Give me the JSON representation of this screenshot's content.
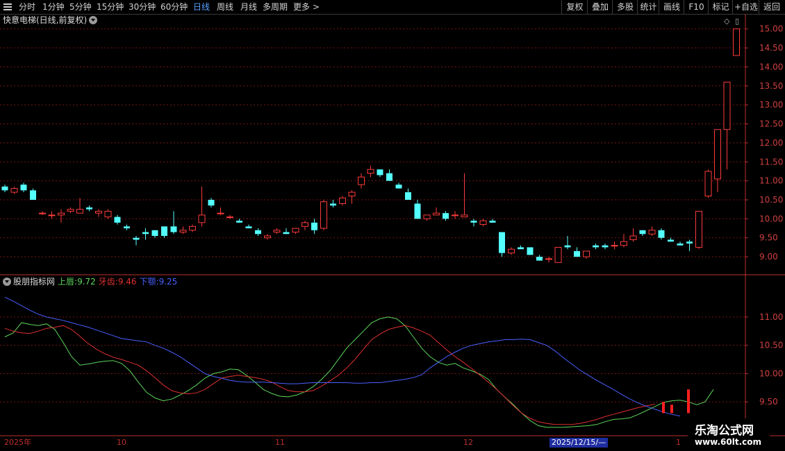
{
  "toolbar": {
    "periods": [
      "分时",
      "1分钟",
      "5分钟",
      "15分钟",
      "30分钟",
      "60分钟",
      "日线",
      "周线",
      "月线",
      "多周期",
      "更多 >"
    ],
    "active_period": "日线",
    "actions": [
      "复权",
      "叠加",
      "多股",
      "统计",
      "画线",
      "F10",
      "标记",
      "+自选",
      "返回"
    ]
  },
  "stock": {
    "title": "快意电梯(日线,前复权)"
  },
  "indicator": {
    "name": "股朋指标网",
    "items": [
      {
        "label": "上唇:",
        "value": "9.72",
        "color": "#5cd65c"
      },
      {
        "label": "牙齿:",
        "value": "9.46",
        "color": "#e03030"
      },
      {
        "label": "下颚:",
        "value": "9.25",
        "color": "#4a60ff"
      }
    ]
  },
  "time_axis": {
    "labels": [
      "2025年",
      "10",
      "11",
      "12",
      "1"
    ],
    "cursor_date": "2025/12/15/—"
  },
  "watermark": {
    "line1": "乐淘公式网",
    "line2": "www.60lt.com"
  },
  "colors": {
    "up": "#ff3b3b",
    "down": "#54ffff",
    "grid": "#7a1515",
    "lips": "#5cd65c",
    "teeth": "#e03030",
    "jaw": "#4a60ff",
    "axis": "#c03030"
  },
  "chart_data": [
    {
      "type": "candlestick",
      "title": "快意电梯(日线,前复权)",
      "y_ticks": [
        "15.00",
        "14.50",
        "14.00",
        "13.50",
        "13.00",
        "12.50",
        "12.00",
        "11.50",
        "11.00",
        "10.50",
        "10.00",
        "9.50",
        "9.00"
      ],
      "ylim": [
        8.6,
        15.25
      ],
      "ohlc": [
        [
          10.85,
          10.9,
          10.7,
          10.75
        ],
        [
          10.7,
          10.85,
          10.65,
          10.8
        ],
        [
          10.9,
          10.95,
          10.7,
          10.75
        ],
        [
          10.75,
          10.8,
          10.5,
          10.5
        ],
        [
          10.15,
          10.2,
          10.1,
          10.15
        ],
        [
          10.1,
          10.2,
          10.0,
          10.1
        ],
        [
          10.1,
          10.25,
          9.9,
          10.15
        ],
        [
          10.2,
          10.3,
          10.15,
          10.25
        ],
        [
          10.15,
          10.55,
          10.15,
          10.25
        ],
        [
          10.3,
          10.35,
          10.2,
          10.25
        ],
        [
          10.15,
          10.25,
          10.05,
          10.2
        ],
        [
          10.05,
          10.25,
          10.0,
          10.2
        ],
        [
          10.05,
          10.1,
          9.85,
          9.9
        ],
        [
          9.8,
          9.85,
          9.7,
          9.75
        ],
        [
          9.5,
          9.55,
          9.3,
          9.45
        ],
        [
          9.65,
          9.75,
          9.45,
          9.6
        ],
        [
          9.7,
          9.7,
          9.5,
          9.55
        ],
        [
          9.8,
          9.8,
          9.5,
          9.55
        ],
        [
          9.8,
          10.2,
          9.6,
          9.65
        ],
        [
          9.65,
          9.8,
          9.6,
          9.7
        ],
        [
          9.7,
          9.85,
          9.65,
          9.8
        ],
        [
          9.9,
          10.85,
          9.8,
          10.1
        ],
        [
          10.5,
          10.55,
          10.3,
          10.35
        ],
        [
          10.15,
          10.3,
          10.1,
          10.15
        ],
        [
          10.05,
          10.1,
          10.0,
          10.05
        ],
        [
          9.95,
          10.0,
          9.9,
          9.9
        ],
        [
          9.8,
          9.85,
          9.75,
          9.75
        ],
        [
          9.7,
          9.75,
          9.55,
          9.6
        ],
        [
          9.5,
          9.6,
          9.45,
          9.55
        ],
        [
          9.65,
          9.75,
          9.6,
          9.7
        ],
        [
          9.65,
          9.75,
          9.6,
          9.6
        ],
        [
          9.65,
          9.75,
          9.6,
          9.75
        ],
        [
          9.8,
          9.95,
          9.7,
          9.9
        ],
        [
          9.9,
          10.0,
          9.6,
          9.7
        ],
        [
          9.75,
          10.5,
          9.7,
          10.45
        ],
        [
          10.4,
          10.5,
          10.3,
          10.35
        ],
        [
          10.4,
          10.6,
          10.35,
          10.55
        ],
        [
          10.6,
          10.75,
          10.4,
          10.7
        ],
        [
          10.9,
          11.2,
          10.8,
          11.1
        ],
        [
          11.2,
          11.4,
          11.1,
          11.3
        ],
        [
          11.3,
          11.3,
          11.1,
          11.15
        ],
        [
          11.2,
          11.3,
          11.0,
          11.0
        ],
        [
          10.9,
          10.95,
          10.8,
          10.8
        ],
        [
          10.7,
          10.8,
          10.5,
          10.5
        ],
        [
          10.4,
          10.5,
          10.0,
          10.0
        ],
        [
          10.0,
          10.1,
          9.95,
          10.1
        ],
        [
          10.1,
          10.3,
          10.1,
          10.15
        ],
        [
          10.15,
          10.2,
          9.95,
          10.0
        ],
        [
          10.1,
          10.2,
          10.0,
          10.1
        ],
        [
          10.05,
          11.2,
          10.05,
          10.1
        ],
        [
          9.95,
          10.0,
          9.8,
          9.9
        ],
        [
          9.85,
          10.0,
          9.8,
          9.95
        ],
        [
          9.95,
          10.0,
          9.9,
          9.9
        ],
        [
          9.65,
          9.65,
          9.0,
          9.1
        ],
        [
          9.1,
          9.25,
          9.05,
          9.2
        ],
        [
          9.25,
          9.3,
          9.2,
          9.2
        ],
        [
          9.25,
          9.25,
          9.05,
          9.05
        ],
        [
          9.0,
          9.05,
          8.9,
          8.9
        ],
        [
          8.95,
          9.0,
          8.85,
          8.95
        ],
        [
          8.85,
          9.25,
          8.85,
          9.25
        ],
        [
          9.3,
          9.55,
          9.2,
          9.25
        ],
        [
          9.15,
          9.25,
          9.0,
          9.0
        ],
        [
          9.0,
          9.15,
          8.95,
          9.15
        ],
        [
          9.3,
          9.35,
          9.2,
          9.25
        ],
        [
          9.3,
          9.35,
          9.2,
          9.25
        ],
        [
          9.3,
          9.4,
          9.2,
          9.3
        ],
        [
          9.3,
          9.6,
          9.25,
          9.4
        ],
        [
          9.45,
          9.75,
          9.4,
          9.55
        ],
        [
          9.7,
          9.7,
          9.55,
          9.6
        ],
        [
          9.6,
          9.8,
          9.55,
          9.7
        ],
        [
          9.7,
          9.75,
          9.45,
          9.5
        ],
        [
          9.45,
          9.5,
          9.4,
          9.4
        ],
        [
          9.35,
          9.4,
          9.3,
          9.3
        ],
        [
          9.4,
          9.45,
          9.15,
          9.35
        ],
        [
          9.25,
          10.2,
          9.2,
          10.2
        ],
        [
          10.6,
          11.3,
          10.55,
          11.25
        ],
        [
          11.05,
          12.35,
          10.7,
          12.35
        ],
        [
          12.35,
          13.6,
          11.3,
          13.6
        ],
        [
          14.3,
          15.0,
          14.3,
          15.0
        ]
      ]
    },
    {
      "type": "line",
      "title": "股朋指标网",
      "y_ticks": [
        "11.00",
        "10.50",
        "10.00",
        "9.50"
      ],
      "ylim": [
        9.0,
        11.6
      ],
      "series": [
        {
          "name": "上唇",
          "color": "#5cd65c",
          "values": [
            10.65,
            10.72,
            10.9,
            10.87,
            10.85,
            10.88,
            10.78,
            10.55,
            10.3,
            10.15,
            10.17,
            10.2,
            10.22,
            10.23,
            10.18,
            10.05,
            9.85,
            9.67,
            9.57,
            9.52,
            9.55,
            9.62,
            9.7,
            9.8,
            9.92,
            10.0,
            10.03,
            10.08,
            10.07,
            9.97,
            9.85,
            9.72,
            9.65,
            9.6,
            9.59,
            9.62,
            9.68,
            9.77,
            9.9,
            10.05,
            10.25,
            10.45,
            10.6,
            10.75,
            10.9,
            10.97,
            11.0,
            10.97,
            10.85,
            10.65,
            10.45,
            10.3,
            10.2,
            10.15,
            10.18,
            10.1,
            10.05,
            9.99,
            9.9,
            9.72,
            9.58,
            9.45,
            9.3,
            9.17,
            9.08,
            9.05,
            9.05,
            9.05,
            9.06,
            9.07,
            9.08,
            9.1,
            9.15,
            9.19,
            9.2,
            9.22,
            9.28,
            9.35,
            9.42,
            9.49,
            9.52,
            9.53,
            9.5,
            9.45,
            9.5,
            9.72
          ]
        },
        {
          "name": "牙齿",
          "color": "#e03030",
          "values": [
            10.8,
            10.75,
            10.72,
            10.71,
            10.75,
            10.8,
            10.82,
            10.85,
            10.78,
            10.66,
            10.53,
            10.43,
            10.35,
            10.29,
            10.25,
            10.2,
            10.15,
            10.05,
            9.93,
            9.8,
            9.7,
            9.66,
            9.64,
            9.66,
            9.72,
            9.82,
            9.92,
            9.95,
            9.97,
            9.95,
            9.93,
            9.9,
            9.85,
            9.77,
            9.7,
            9.68,
            9.68,
            9.7,
            9.78,
            9.87,
            9.97,
            10.1,
            10.25,
            10.43,
            10.6,
            10.7,
            10.78,
            10.82,
            10.85,
            10.81,
            10.75,
            10.68,
            10.55,
            10.42,
            10.3,
            10.2,
            10.09,
            9.97,
            9.85,
            9.72,
            9.58,
            9.43,
            9.3,
            9.21,
            9.15,
            9.12,
            9.1,
            9.1,
            9.1,
            9.12,
            9.15,
            9.19,
            9.24,
            9.28,
            9.32,
            9.36,
            9.4,
            9.43,
            9.46
          ]
        },
        {
          "name": "下颚",
          "color": "#4a60ff",
          "values": [
            11.35,
            11.28,
            11.2,
            11.12,
            11.05,
            11.0,
            10.97,
            10.94,
            10.9,
            10.86,
            10.82,
            10.77,
            10.72,
            10.67,
            10.62,
            10.6,
            10.58,
            10.56,
            10.5,
            10.45,
            10.38,
            10.3,
            10.2,
            10.1,
            10.0,
            9.95,
            9.92,
            9.88,
            9.86,
            9.85,
            9.85,
            9.85,
            9.84,
            9.83,
            9.82,
            9.82,
            9.83,
            9.84,
            9.84,
            9.84,
            9.84,
            9.84,
            9.83,
            9.83,
            9.84,
            9.84,
            9.86,
            9.88,
            9.9,
            9.93,
            9.98,
            10.1,
            10.2,
            10.3,
            10.38,
            10.45,
            10.5,
            10.53,
            10.56,
            10.58,
            10.6,
            10.6,
            10.61,
            10.6,
            10.55,
            10.5,
            10.4,
            10.28,
            10.17,
            10.06,
            9.97,
            9.88,
            9.8,
            9.72,
            9.63,
            9.55,
            9.48,
            9.42,
            9.37,
            9.32,
            9.28,
            9.25
          ]
        }
      ],
      "signal_bars": [
        {
          "index": 79,
          "top": 9.5
        },
        {
          "index": 80,
          "top": 9.45
        },
        {
          "index": 82,
          "top": 9.72
        }
      ]
    }
  ]
}
